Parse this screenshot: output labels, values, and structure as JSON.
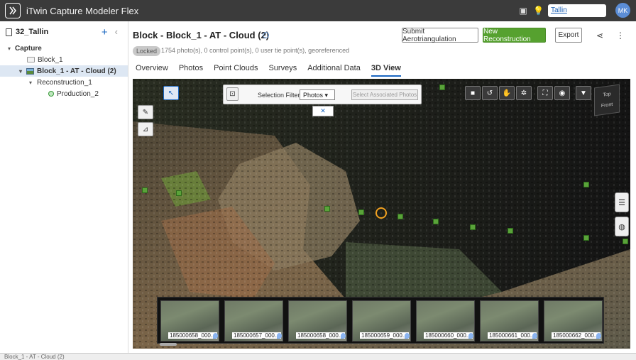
{
  "app": {
    "title": "iTwin Capture Modeler Flex"
  },
  "titlebar": {
    "project_search": "Tallin",
    "avatar_initials": "MK"
  },
  "sidebar": {
    "project_name": "32_Tallin",
    "tree": {
      "capture": "Capture",
      "block": "Block_1",
      "at_block": "Block_1 - AT - Cloud (2)",
      "reconstruction": "Reconstruction_1",
      "production": "Production_2"
    }
  },
  "header": {
    "title": "Block -  Block_1 - AT - Cloud (2)",
    "status_badge": "Locked",
    "summary": "1754 photo(s), 0 control point(s), 0 user tie point(s), georeferenced",
    "submit_label": "Submit Aerotriangulation",
    "new_reconstruction_label": "New Reconstruction",
    "export_label": "Export"
  },
  "tabs": [
    {
      "label": "Overview"
    },
    {
      "label": "Photos"
    },
    {
      "label": "Point Clouds"
    },
    {
      "label": "Surveys"
    },
    {
      "label": "Additional Data"
    },
    {
      "label": "3D View"
    }
  ],
  "viewport": {
    "selection_filter_label": "Selection Filter:",
    "selection_filter_value": "Photos",
    "associated_photos_label": "Select Associated Photos",
    "cube_top": "Top",
    "cube_front": "Front",
    "thumbnails": [
      "185000658_000...",
      "185000657_000...",
      "185000658_000...",
      "185000659_000...",
      "185000660_000...",
      "185000661_000...",
      "185000662_000..."
    ]
  },
  "statusbar": {
    "text": "Block_1 - AT - Cloud (2)"
  },
  "colors": {
    "titlebar": "#3b3b3b",
    "accent": "#1a66c0",
    "primary_button": "#56a12f",
    "selected_row": "#dde7f3"
  }
}
